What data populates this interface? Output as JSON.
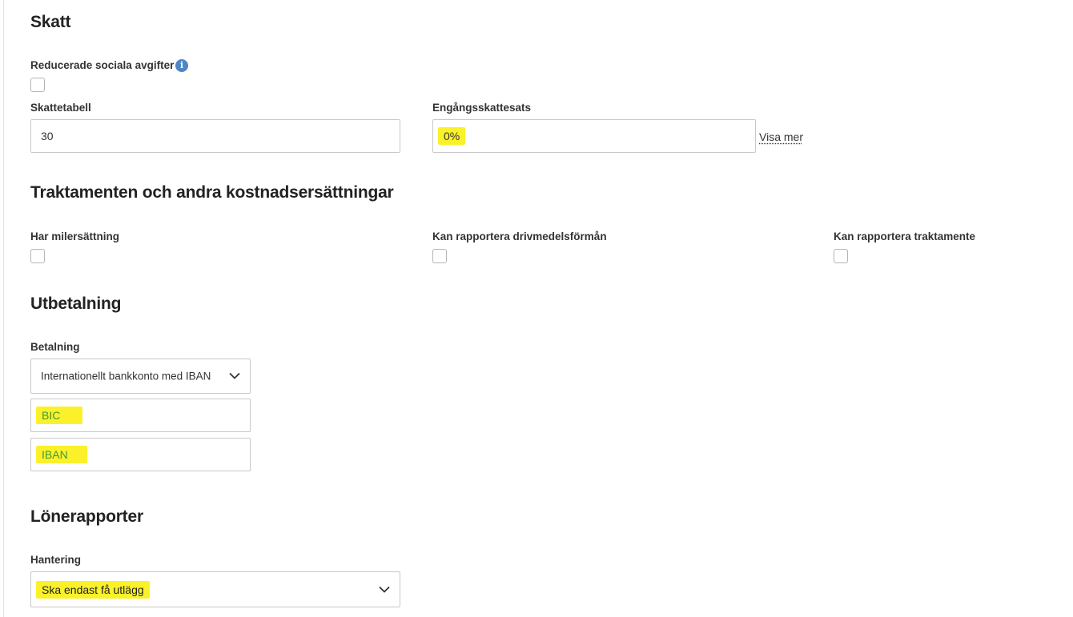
{
  "skatt": {
    "heading": "Skatt",
    "reduced_social_label": "Reducerade sociala avgifter",
    "info_icon": "info-icon",
    "tax_table_label": "Skattetabell",
    "tax_table_value": "30",
    "one_time_tax_label": "Engångsskattesats",
    "one_time_tax_value": "0%",
    "show_more_link": "Visa mer"
  },
  "allowances": {
    "heading": "Traktamenten och andra kostnadsersättningar",
    "mileage_label": "Har milersättning",
    "fuel_benefit_label": "Kan rapportera drivmedelsförmån",
    "per_diem_label": "Kan rapportera traktamente"
  },
  "payout": {
    "heading": "Utbetalning",
    "payment_label": "Betalning",
    "payment_value": "Internationellt bankkonto med IBAN",
    "bic_placeholder": "BIC",
    "iban_placeholder": "IBAN"
  },
  "salary_reports": {
    "heading": "Lönerapporter",
    "handling_label": "Hantering",
    "handling_value": "Ska endast få utlägg"
  },
  "colors": {
    "highlight": "#fbf12a",
    "info_icon": "#4e86c4"
  }
}
